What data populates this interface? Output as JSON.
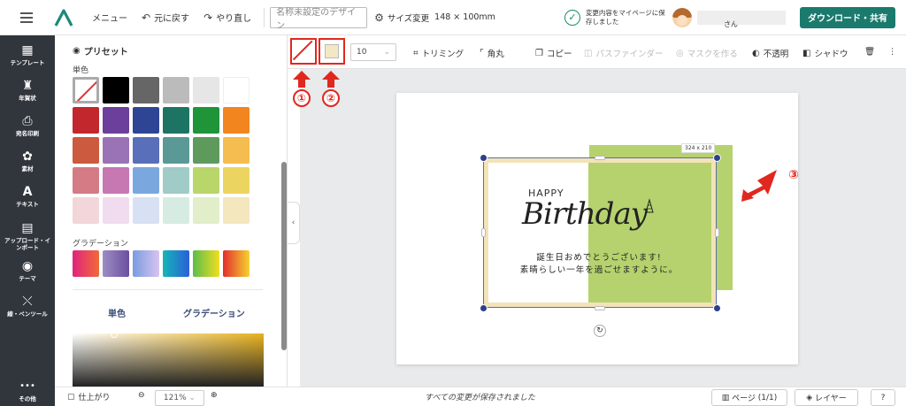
{
  "header": {
    "menu_label": "メニュー",
    "undo_label": "元に戻す",
    "redo_label": "やり直し",
    "design_name_placeholder": "名称未設定のデザイン",
    "size_change_label": "サイズ変更",
    "size_value": "148 × 100mm",
    "saved_message": "変更内容をマイページに保存しました",
    "user_suffix": "さん",
    "download_label": "ダウンロード・共有"
  },
  "rail": {
    "items": [
      {
        "label": "テンプレート",
        "icon": "template-icon"
      },
      {
        "label": "年賀状",
        "icon": "newyear-card-icon"
      },
      {
        "label": "宛名印刷",
        "icon": "printer-icon"
      },
      {
        "label": "素材",
        "icon": "material-icon"
      },
      {
        "label": "テキスト",
        "icon": "text-icon"
      },
      {
        "label": "アップロード・インポート",
        "icon": "upload-icon"
      },
      {
        "label": "テーマ",
        "icon": "palette-icon"
      },
      {
        "label": "線・ペンツール",
        "icon": "pen-tool-icon"
      },
      {
        "label": "その他",
        "icon": "more-icon"
      }
    ]
  },
  "panel": {
    "title": "プリセット",
    "solid_label": "単色",
    "gradient_label": "グラデーション",
    "tab_solid": "単色",
    "tab_gradient": "グラデーション",
    "solid_colors": [
      [
        "none",
        "#000000",
        "#666666",
        "#bbbbbb",
        "#e6e6e6",
        "#ffffff"
      ],
      [
        "#c1272d",
        "#6b3f9b",
        "#2e4596",
        "#1d7465",
        "#1f9438",
        "#f2851e"
      ],
      [
        "#cc5a3e",
        "#9a73b6",
        "#5a6fba",
        "#5a9996",
        "#5f9a5d",
        "#f5bc4f"
      ],
      [
        "#d57b85",
        "#c777b2",
        "#7aa8de",
        "#a0cbc6",
        "#b8d66a",
        "#ecd460"
      ],
      [
        "#f2d6d9",
        "#f0dcee",
        "#d8e0f3",
        "#d6ece3",
        "#e1eec9",
        "#f4e6bd"
      ]
    ],
    "gradients": [
      [
        "#e0237e",
        "#f16a39"
      ],
      [
        "#9b8ec4",
        "#6b4ea0"
      ],
      [
        "#7a9ce0",
        "#d7c4ef"
      ],
      [
        "#16b6b6",
        "#2a5fd8"
      ],
      [
        "#5bbd4a",
        "#f1de22"
      ],
      [
        "#e22e2e",
        "#f6d330"
      ]
    ]
  },
  "toolbar": {
    "stroke_width": "10",
    "trim_label": "トリミング",
    "corner_label": "角丸",
    "copy_label": "コピー",
    "pathfinder_label": "パスファインダー",
    "mask_label": "マスクを作る",
    "opacity_label": "不透明",
    "shadow_label": "シャドウ"
  },
  "canvas": {
    "size_tag": "324 x 210",
    "happy_text": "HAPPY",
    "birthday_text": "Birthday",
    "line1": "誕生日おめでとうございます!",
    "line2": "素晴らしい一年を過ごせますように。",
    "card_border_color": "#f3e3b8",
    "green_color": "#b5d26e"
  },
  "annotations": {
    "n1": "①",
    "n2": "②",
    "n3": "③",
    "color": "#e0281e"
  },
  "statusbar": {
    "finish_label": "仕上がり",
    "zoom_value": "121%",
    "saved_all": "すべての変更が保存されました",
    "pages_label": "ページ",
    "pages_count": "(1/1)",
    "layers_label": "レイヤー",
    "help": "?"
  }
}
